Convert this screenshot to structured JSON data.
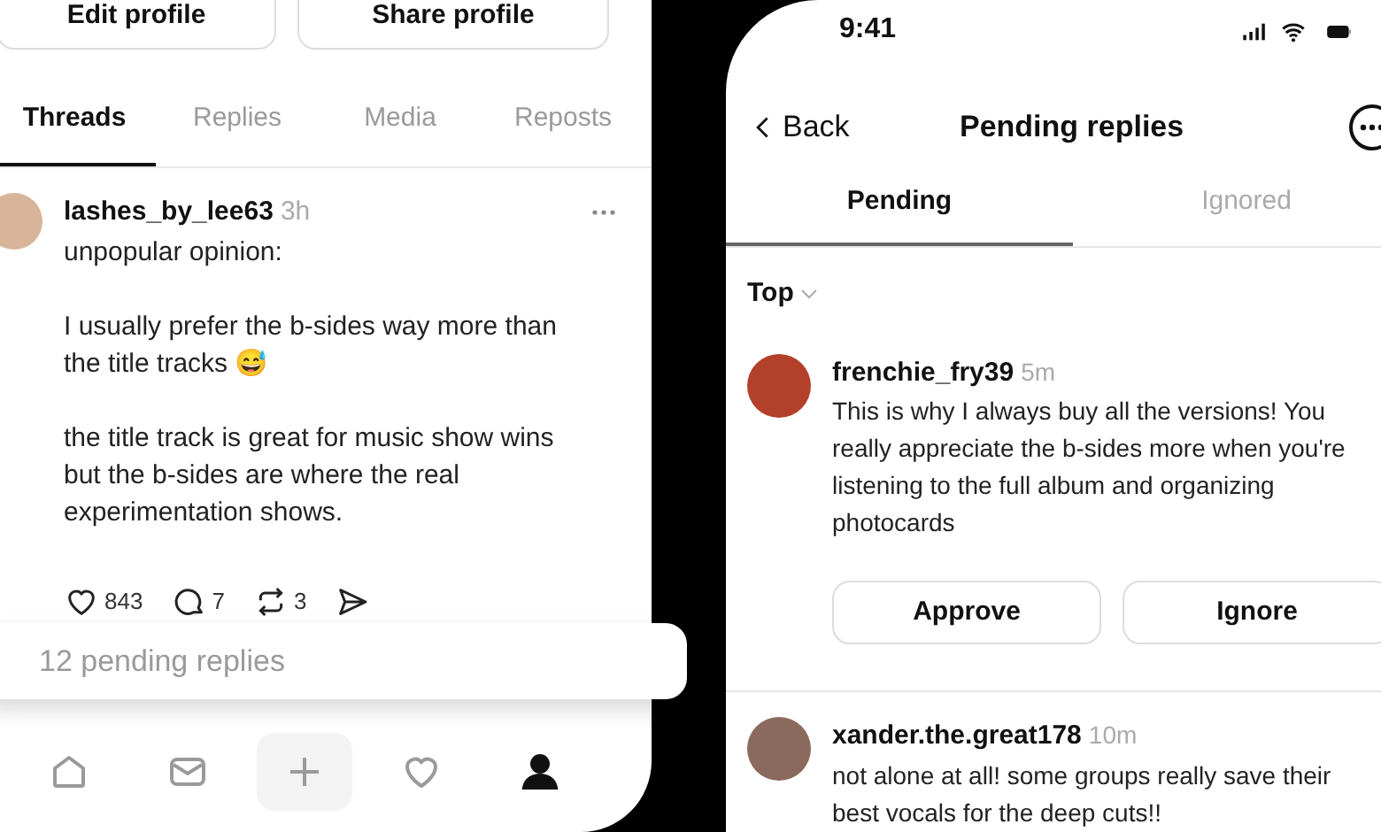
{
  "profile_screen": {
    "buttons": [
      "Edit profile",
      "Share profile"
    ],
    "tabs": [
      {
        "label": "Threads",
        "selected": true
      },
      {
        "label": "Replies",
        "selected": false
      },
      {
        "label": "Media",
        "selected": false
      },
      {
        "label": "Reposts",
        "selected": false
      }
    ],
    "post": {
      "username": "lashes_by_lee63",
      "time": "3h",
      "paragraphs": [
        "unpopular opinion:",
        "I usually prefer the b-sides way more than the title tracks 😅",
        "the title track is great for music show wins but the b-sides are  where the real experimentation shows."
      ],
      "actions": [
        {
          "kind": "like",
          "count": "843"
        },
        {
          "kind": "reply",
          "count": "7"
        },
        {
          "kind": "repost",
          "count": "3"
        },
        {
          "kind": "share"
        }
      ]
    },
    "pending_banner": "12 pending replies",
    "nav": [
      {
        "kind": "home",
        "selected": false
      },
      {
        "kind": "messages",
        "selected": false
      },
      {
        "kind": "create",
        "selected": false
      },
      {
        "kind": "activity",
        "selected": false
      },
      {
        "kind": "profile",
        "selected": true
      }
    ]
  },
  "pending_screen": {
    "status_bar": {
      "time": "9:41"
    },
    "back": "Back",
    "title": "Pending replies",
    "tabs": [
      {
        "label": "Pending",
        "selected": true
      },
      {
        "label": "Ignored",
        "selected": false
      }
    ],
    "sort": "Top",
    "replies": [
      {
        "username": "frenchie_fry39",
        "time": "5m",
        "text": "This is why I always buy all the versions! You really appreciate the b-sides more when you're listening to the full album and organizing photocards",
        "buttons": [
          "Approve",
          "Ignore"
        ]
      },
      {
        "username": "xander.the.great178",
        "time": "10m",
        "text": "not alone at all! some groups really save their best vocals for the deep cuts!!"
      }
    ]
  }
}
